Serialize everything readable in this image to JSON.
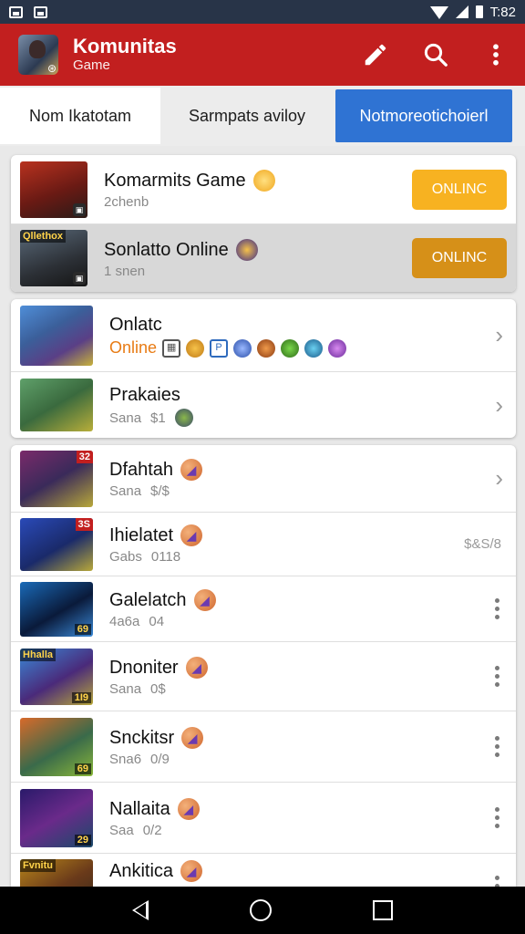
{
  "status": {
    "time": "T:82"
  },
  "appbar": {
    "title": "Komunitas",
    "subtitle": "Game",
    "icons": [
      "edit-icon",
      "search-icon",
      "more-vert-icon"
    ]
  },
  "tabs": [
    {
      "label": "Nom Ikatotam"
    },
    {
      "label": "Sarmpats aviloy"
    },
    {
      "label": "Notmoreotichoierl"
    }
  ],
  "featured": [
    {
      "title": "Komarmits Game",
      "meta": "2chenb",
      "button": "ONLINC"
    },
    {
      "title": "Sonlatto Online",
      "meta": "1 snen",
      "button": "ONLINC",
      "thumb_label": "Qllethox"
    }
  ],
  "group": [
    {
      "title": "Onlatc",
      "status": "Online",
      "action": "›"
    },
    {
      "title": "Prakaies",
      "meta1": "Sana",
      "meta2": "$1",
      "action": "›"
    }
  ],
  "list": [
    {
      "title": "Dfahtah",
      "meta1": "Sana",
      "meta2": "$/$",
      "badge": "32",
      "action": "›"
    },
    {
      "title": "Ihielatet",
      "meta1": "Gabs",
      "meta2": "0118",
      "badge": "3S",
      "extra": "$&S/8"
    },
    {
      "title": "Galelatch",
      "meta1": "4a6a",
      "meta2": "04",
      "level": "69"
    },
    {
      "title": "Dnoniter",
      "meta1": "Sana",
      "meta2": "0$",
      "level": "1I9",
      "thumb_label": "Hhalla"
    },
    {
      "title": "Snckitsr",
      "meta1": "Sna6",
      "meta2": "0/9",
      "level": "69"
    },
    {
      "title": "Nallaita",
      "meta1": "Saa",
      "meta2": "0/2",
      "level": "29"
    },
    {
      "title": "Ankitica",
      "thumb_label": "Fvnitu"
    }
  ]
}
